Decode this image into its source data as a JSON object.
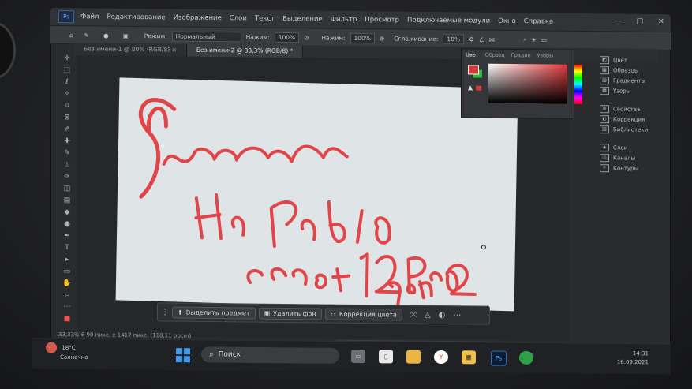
{
  "menu": {
    "items": [
      "Файл",
      "Редактирование",
      "Изображение",
      "Слои",
      "Текст",
      "Выделение",
      "Фильтр",
      "Просмотр",
      "Подключаемые модули",
      "Окно",
      "Справка"
    ]
  },
  "options": {
    "mode_label": "Режим:",
    "mode_value": "Нормальный",
    "pressure_label": "Нажим:",
    "pressure_value": "100%",
    "opacity_label": "Нажим:",
    "opacity_value": "100%",
    "smoothing_label": "Сглаживание:",
    "smoothing_value": "10%"
  },
  "tabs": [
    {
      "label": "Без имени-1 @ 80% (RGB/8) ×"
    },
    {
      "label": "Без имени-2 @ 33,3% (RGB/8) *"
    }
  ],
  "canvas": {
    "line1": "Рисование",
    "line2": "На Parblo",
    "line3": "coast 12Pro",
    "line4": "gen2",
    "ink_color": "#e0454a"
  },
  "color_panel": {
    "tabs": [
      "Цвет",
      "Образц",
      "Градие",
      "Узоры"
    ],
    "fg_color": "#d13a3a",
    "bg_color": "#27c040"
  },
  "right_panel": {
    "group1": [
      "Цвет",
      "Образцы",
      "Градиенты",
      "Узоры"
    ],
    "group2": [
      "Свойства",
      "Коррекция",
      "Библиотеки"
    ],
    "group3": [
      "Слои",
      "Каналы",
      "Контуры"
    ]
  },
  "context_bar": {
    "select_subject": "Выделить предмет",
    "remove_bg": "Удалить фон",
    "color_correction": "Коррекция цвета"
  },
  "status": {
    "text": "33,33% 6 90 пикс. x 1417 пикс. (118,11 ppcm)"
  },
  "taskbar": {
    "weather_temp": "18°C",
    "weather_desc": "Солнечно",
    "search_label": "Поиск",
    "time": "14:31",
    "date": "16.09.2021"
  }
}
